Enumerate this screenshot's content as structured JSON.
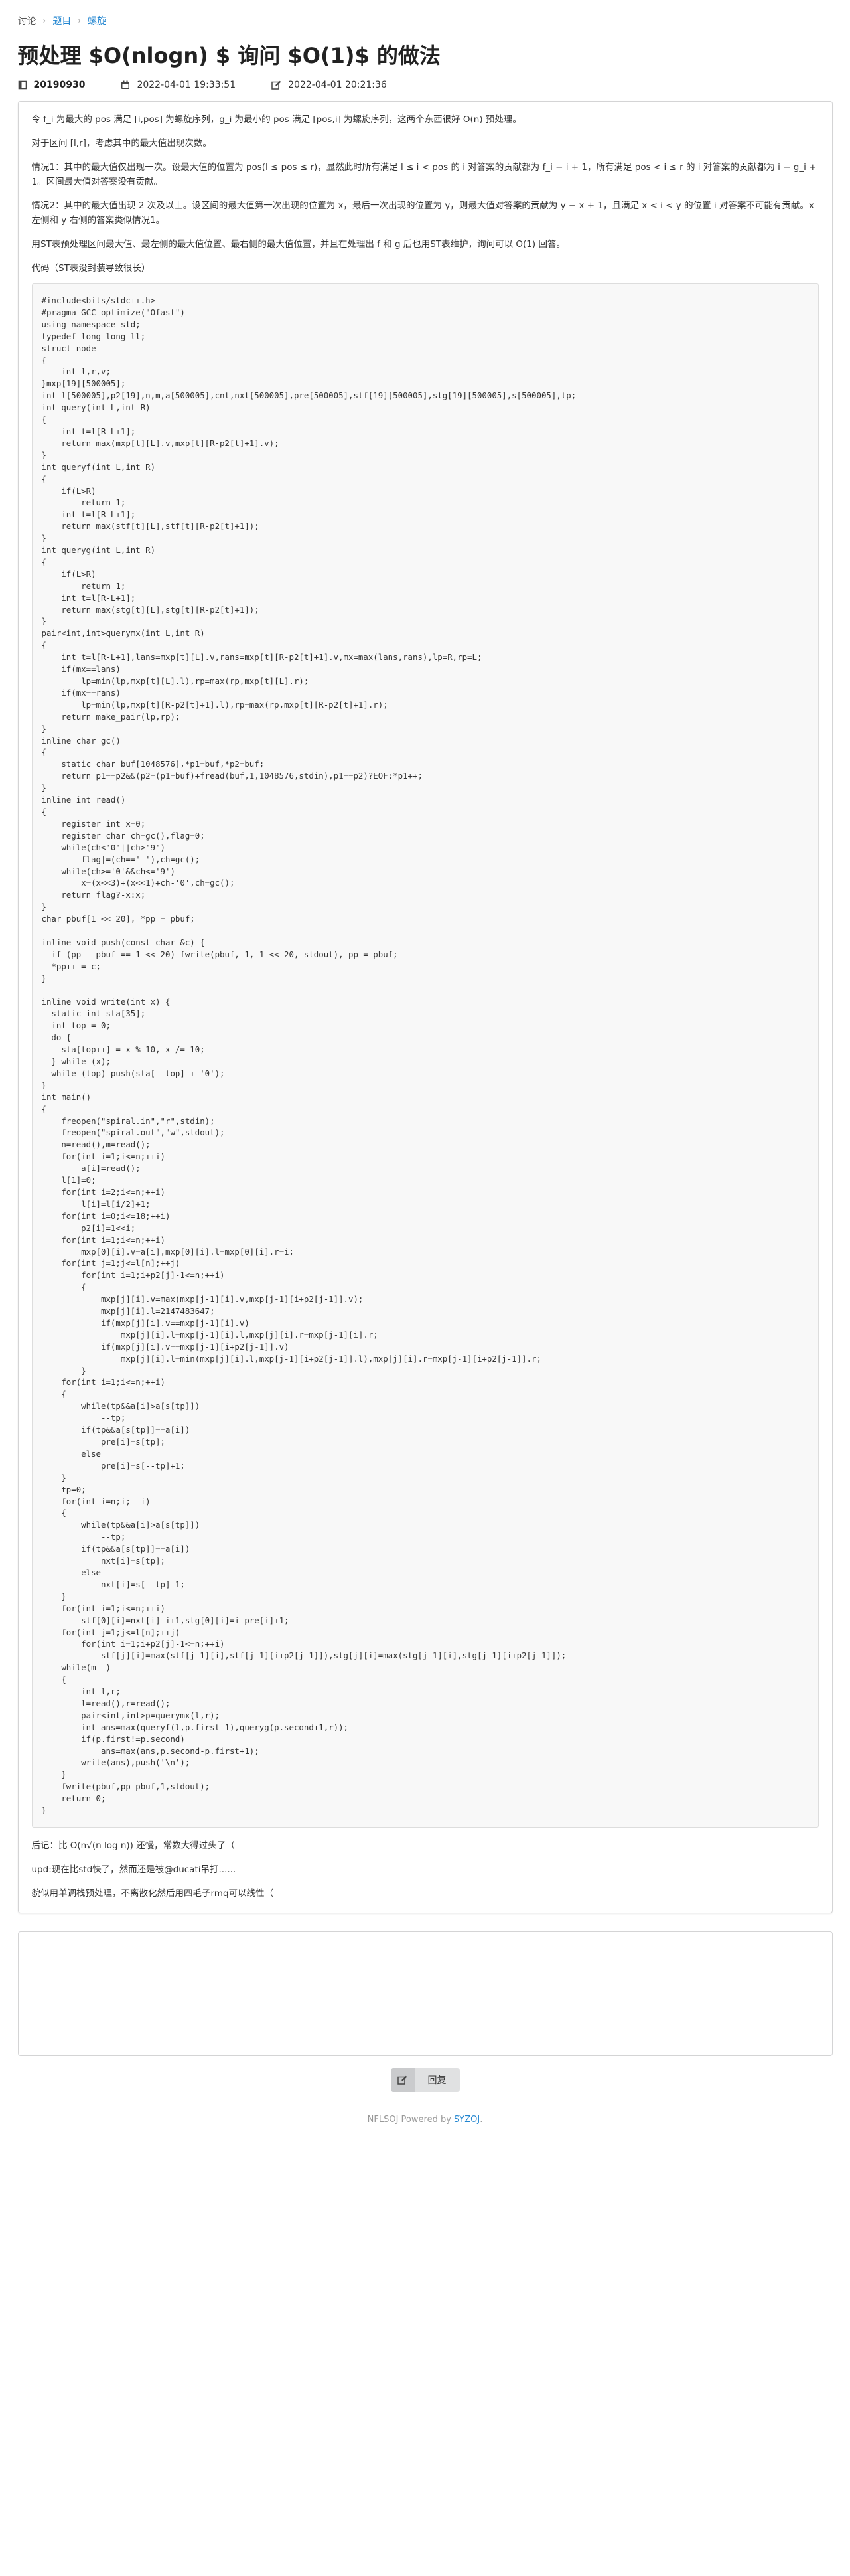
{
  "breadcrumb": {
    "root": "讨论",
    "sep": "›",
    "section": "题目",
    "topic": "螺旋"
  },
  "title": "预处理 $O(nlogn) $ 询问 $O(1)$ 的做法",
  "meta": {
    "author": "20190930",
    "created": "2022-04-01 19:33:51",
    "edited": "2022-04-01 20:21:36"
  },
  "article": {
    "p1": "令 f_i 为最大的 pos 满足 [i,pos] 为螺旋序列，g_i 为最小的 pos 满足 [pos,i] 为螺旋序列，这两个东西很好 O(n) 预处理。",
    "p2": "对于区间 [l,r]，考虑其中的最大值出现次数。",
    "p3": "情况1：其中的最大值仅出现一次。设最大值的位置为 pos(l ≤ pos ≤ r)，显然此时所有满足 l ≤ i < pos 的 i 对答案的贡献都为 f_i − i + 1，所有满足 pos < i ≤ r 的 i 对答案的贡献都为 i − g_i + 1。区间最大值对答案没有贡献。",
    "p4": "情况2：其中的最大值出现 2 次及以上。设区间的最大值第一次出现的位置为 x，最后一次出现的位置为 y，则最大值对答案的贡献为 y − x + 1，且满足 x < i < y 的位置 i 对答案不可能有贡献。x 左侧和 y 右侧的答案类似情况1。",
    "p5": "用ST表预处理区间最大值、最左侧的最大值位置、最右侧的最大值位置，并且在处理出 f 和 g 后也用ST表维护，询问可以 O(1) 回答。",
    "p6": "代码（ST表没封装导致很长）",
    "code": "#include<bits/stdc++.h>\n#pragma GCC optimize(\"Ofast\")\nusing namespace std;\ntypedef long long ll;\nstruct node\n{\n    int l,r,v;\n}mxp[19][500005];\nint l[500005],p2[19],n,m,a[500005],cnt,nxt[500005],pre[500005],stf[19][500005],stg[19][500005],s[500005],tp;\nint query(int L,int R)\n{\n    int t=l[R-L+1];\n    return max(mxp[t][L].v,mxp[t][R-p2[t]+1].v);\n}\nint queryf(int L,int R)\n{\n    if(L>R)\n        return 1;\n    int t=l[R-L+1];\n    return max(stf[t][L],stf[t][R-p2[t]+1]);\n}\nint queryg(int L,int R)\n{\n    if(L>R)\n        return 1;\n    int t=l[R-L+1];\n    return max(stg[t][L],stg[t][R-p2[t]+1]);\n}\npair<int,int>querymx(int L,int R)\n{\n    int t=l[R-L+1],lans=mxp[t][L].v,rans=mxp[t][R-p2[t]+1].v,mx=max(lans,rans),lp=R,rp=L;\n    if(mx==lans)\n        lp=min(lp,mxp[t][L].l),rp=max(rp,mxp[t][L].r);\n    if(mx==rans)\n        lp=min(lp,mxp[t][R-p2[t]+1].l),rp=max(rp,mxp[t][R-p2[t]+1].r);\n    return make_pair(lp,rp);\n}\ninline char gc()\n{\n    static char buf[1048576],*p1=buf,*p2=buf;\n    return p1==p2&&(p2=(p1=buf)+fread(buf,1,1048576,stdin),p1==p2)?EOF:*p1++;\n}\ninline int read()\n{\n    register int x=0;\n    register char ch=gc(),flag=0;\n    while(ch<'0'||ch>'9')\n        flag|=(ch=='-'),ch=gc();\n    while(ch>='0'&&ch<='9')\n        x=(x<<3)+(x<<1)+ch-'0',ch=gc();\n    return flag?-x:x;\n}\nchar pbuf[1 << 20], *pp = pbuf;\n\ninline void push(const char &c) {\n  if (pp - pbuf == 1 << 20) fwrite(pbuf, 1, 1 << 20, stdout), pp = pbuf;\n  *pp++ = c;\n}\n\ninline void write(int x) {\n  static int sta[35];\n  int top = 0;\n  do {\n    sta[top++] = x % 10, x /= 10;\n  } while (x);\n  while (top) push(sta[--top] + '0');\n}\nint main()\n{\n    freopen(\"spiral.in\",\"r\",stdin);\n    freopen(\"spiral.out\",\"w\",stdout);\n    n=read(),m=read();\n    for(int i=1;i<=n;++i)\n        a[i]=read();\n    l[1]=0;\n    for(int i=2;i<=n;++i)\n        l[i]=l[i/2]+1;\n    for(int i=0;i<=18;++i)\n        p2[i]=1<<i;\n    for(int i=1;i<=n;++i)\n        mxp[0][i].v=a[i],mxp[0][i].l=mxp[0][i].r=i;\n    for(int j=1;j<=l[n];++j)\n        for(int i=1;i+p2[j]-1<=n;++i)\n        {\n            mxp[j][i].v=max(mxp[j-1][i].v,mxp[j-1][i+p2[j-1]].v);\n            mxp[j][i].l=2147483647;\n            if(mxp[j][i].v==mxp[j-1][i].v)\n                mxp[j][i].l=mxp[j-1][i].l,mxp[j][i].r=mxp[j-1][i].r;\n            if(mxp[j][i].v==mxp[j-1][i+p2[j-1]].v)\n                mxp[j][i].l=min(mxp[j][i].l,mxp[j-1][i+p2[j-1]].l),mxp[j][i].r=mxp[j-1][i+p2[j-1]].r;\n        }\n    for(int i=1;i<=n;++i)\n    {\n        while(tp&&a[i]>a[s[tp]])\n            --tp;\n        if(tp&&a[s[tp]]==a[i])\n            pre[i]=s[tp];\n        else\n            pre[i]=s[--tp]+1;\n    }\n    tp=0;\n    for(int i=n;i;--i)\n    {\n        while(tp&&a[i]>a[s[tp]])\n            --tp;\n        if(tp&&a[s[tp]]==a[i])\n            nxt[i]=s[tp];\n        else\n            nxt[i]=s[--tp]-1;\n    }\n    for(int i=1;i<=n;++i)\n        stf[0][i]=nxt[i]-i+1,stg[0][i]=i-pre[i]+1;\n    for(int j=1;j<=l[n];++j)\n        for(int i=1;i+p2[j]-1<=n;++i)\n            stf[j][i]=max(stf[j-1][i],stf[j-1][i+p2[j-1]]),stg[j][i]=max(stg[j-1][i],stg[j-1][i+p2[j-1]]);\n    while(m--)\n    {\n        int l,r;\n        l=read(),r=read();\n        pair<int,int>p=querymx(l,r);\n        int ans=max(queryf(l,p.first-1),queryg(p.second+1,r));\n        if(p.first!=p.second)\n            ans=max(ans,p.second-p.first+1);\n        write(ans),push('\\n');\n    }\n    fwrite(pbuf,pp-pbuf,1,stdout);\n    return 0;\n}",
    "after1": "后记：比 O(n√(n log n)) 还慢，常数大得过头了（",
    "after2": "upd:现在比std快了，然而还是被@ducati吊打......",
    "after3": "貌似用单调栈预处理，不离散化然后用四毛子rmq可以线性（"
  },
  "reply": {
    "placeholder": "",
    "button_label": "回复"
  },
  "powered": {
    "prefix": "NFLSOJ Powered by ",
    "brand": "SYZOJ",
    "suffix": "."
  }
}
